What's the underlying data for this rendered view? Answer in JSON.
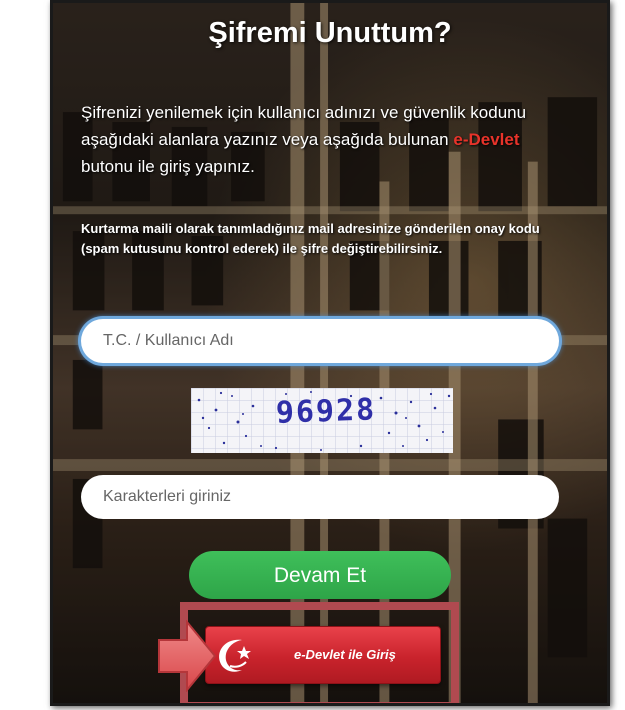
{
  "page": {
    "title": "Şifremi Unuttum?"
  },
  "intro": {
    "text_before": "Şifrenizi yenilemek için kullanıcı adınızı ve güvenlik kodunu aşağıdaki alanlara yazınız veya aşağıda bulunan ",
    "edevlet_word": "e-Devlet",
    "text_after": " butonu ile giriş yapınız."
  },
  "note": {
    "text": "Kurtarma maili olarak tanımladığınız mail adresinize gönderilen onay kodu (spam kutusunu kontrol ederek) ile şifre değiştirebilirsiniz."
  },
  "form": {
    "username_placeholder": "T.C. / Kullanıcı Adı",
    "username_value": "",
    "captcha_code": "96928",
    "captcha_placeholder": "Karakterleri giriniz",
    "captcha_value": ""
  },
  "buttons": {
    "continue_label": "Devam Et",
    "edevlet_label": "e-Devlet ile Giriş"
  },
  "colors": {
    "continue_green": "#2ea548",
    "edevlet_red": "#c9232c",
    "highlight_border": "#b04a50",
    "input_focus": "#4a90d9"
  },
  "icons": {
    "edevlet_logo": "edevlet-crescent-logo",
    "pointer_arrow": "arrow-right-icon"
  }
}
